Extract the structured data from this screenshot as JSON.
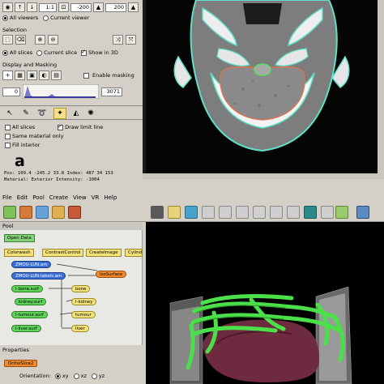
{
  "top_panel": {
    "viewer_row": {
      "zoom_value": "1:1",
      "spin1_value": "-200",
      "spin2_value": "200"
    },
    "viewer_options": {
      "all_viewers": "All viewers",
      "current_viewer": "Current viewer"
    },
    "selection": {
      "heading": "Selection",
      "all_slices": "All slices",
      "current_slice": "Current slice",
      "show_in_3d": "Show in 3D"
    },
    "display_masking": {
      "heading": "Display and Masking",
      "enable_masking": "Enable masking",
      "low_value": "0",
      "high_value": "3071"
    },
    "tool_options": {
      "all_slices": "All slices",
      "draw_limit_line": "Draw limit line",
      "same_material_only": "Same material only",
      "fill_interior": "Fill interior"
    },
    "figure_label": "a",
    "info": {
      "line1": "Pos: 109.4 -245.2 33.8   Index: 487 34 153",
      "line2": "Material: Exterior       Intensity: -1004"
    }
  },
  "menubar": {
    "items": [
      "File",
      "Edit",
      "Pool",
      "Create",
      "View",
      "VR",
      "Help"
    ]
  },
  "pool": {
    "heading": "Pool",
    "open_data": "Open Data",
    "buttons": [
      "Colorwash",
      "ContrastControl",
      "CreateImage",
      "Cylind"
    ],
    "nodes": [
      "ZMOU-LUN.am",
      "ZMOU-LUN-labels.am",
      "IsoSurface",
      "l-bone.surf",
      "bone",
      "kidney.surf",
      "l-kidney",
      "l-tumour.surf",
      "tumour",
      "l-liver.surf",
      "liver"
    ]
  },
  "properties": {
    "heading": "Properties",
    "module": "OrthoSlice2",
    "orientation_label": "Orientation:",
    "orientation_options": [
      "xy",
      "xz",
      "yz"
    ]
  },
  "colors": {
    "panel": "#d4d0c8",
    "node_green": "#5fd35a",
    "node_blue": "#3b6fd8",
    "node_orange": "#f08a2c",
    "bone_green": "#4be04a",
    "liver": "#6e2a3e"
  }
}
